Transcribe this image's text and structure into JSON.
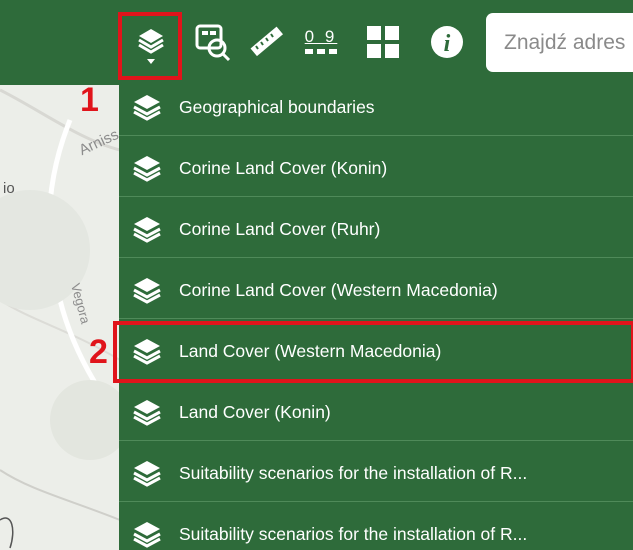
{
  "toolbar": {
    "tools": [
      {
        "name": "layers-icon"
      },
      {
        "name": "map-legend-icon"
      },
      {
        "name": "measure-ruler-icon"
      },
      {
        "name": "scale-icon",
        "text_top": "0 9"
      },
      {
        "name": "basemap-grid-icon"
      },
      {
        "name": "info-icon",
        "text": "i"
      }
    ],
    "search_placeholder": "Znajdź adres"
  },
  "callouts": {
    "one": "1",
    "two": "2"
  },
  "map_labels": {
    "left_fragment": "io",
    "road_top": "Arniss",
    "road_side": "Vegora"
  },
  "layers_menu": {
    "items": [
      {
        "label": "Geographical boundaries"
      },
      {
        "label": "Corine Land Cover (Konin)"
      },
      {
        "label": "Corine Land Cover (Ruhr)"
      },
      {
        "label": "Corine Land Cover (Western Macedonia)"
      },
      {
        "label": "Land Cover (Western Macedonia)"
      },
      {
        "label": "Land Cover (Konin)"
      },
      {
        "label": "Suitability scenarios for the installation of R..."
      },
      {
        "label": "Suitability scenarios for the installation of R..."
      }
    ]
  },
  "colors": {
    "toolbar": "#2e6b3a",
    "highlight": "#e0141b",
    "text": "#ffffff"
  }
}
